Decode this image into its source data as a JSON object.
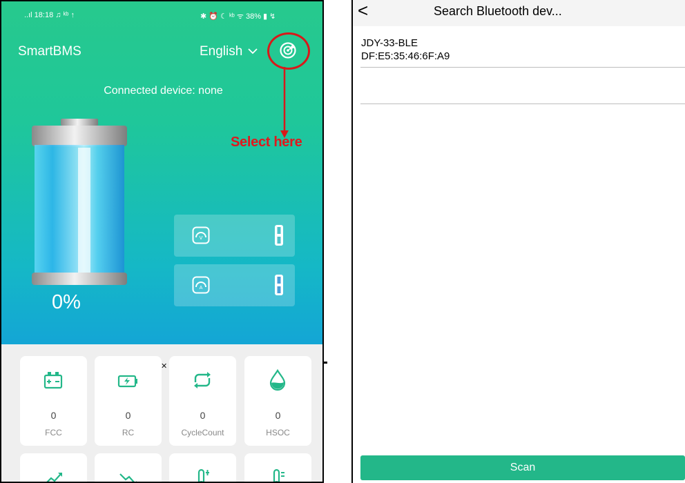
{
  "status_bar": {
    "left": "..ıl 18:18 ♫ ᵏᵇ ↑",
    "right": "✱ ⏰ ☾ ᵏᵇ ᯤ 38% ▮ ↯"
  },
  "app": {
    "title": "SmartBMS",
    "language": "English",
    "connected_text": "Connected device: none",
    "annotation": "Select here",
    "battery_percent": "0%",
    "battery_level": 0,
    "voltage_value": "0",
    "current_value": "0",
    "stats": [
      {
        "value": "0",
        "label": "FCC",
        "icon": "battery-plus-minus-icon"
      },
      {
        "value": "0",
        "label": "RC",
        "icon": "battery-charging-icon"
      },
      {
        "value": "0",
        "label": "CycleCount",
        "icon": "cycle-arrows-icon"
      },
      {
        "value": "0",
        "label": "HSOC",
        "icon": "water-drop-icon"
      }
    ],
    "accent_color": "#23b789",
    "annotation_color": "#e0181d"
  },
  "bluetooth": {
    "back_label": "<",
    "title": "Search Bluetooth dev...",
    "devices": [
      {
        "name": "JDY-33-BLE",
        "mac": "DF:E5:35:46:6F:A9"
      }
    ],
    "scan_label": "Scan"
  }
}
